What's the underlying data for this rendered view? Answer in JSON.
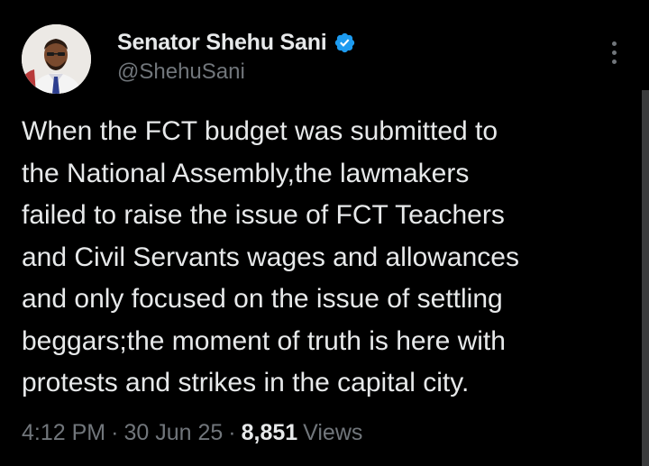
{
  "author": {
    "display_name": "Senator Shehu Sani",
    "handle": "@ShehuSani",
    "verified_color": "#1d9bf0"
  },
  "tweet": {
    "text": "When the FCT budget was submitted to\nthe National Assembly,the lawmakers\nfailed to raise the issue of FCT Teachers\nand Civil Servants wages and allowances\nand only focused on the issue of settling\nbeggars;the moment of truth is here with\nprotests and strikes in the capital city.",
    "time": "4:12 PM",
    "date": "30 Jun 25",
    "separator": "·",
    "views_count": "8,851",
    "views_label": "Views"
  },
  "icons": {
    "verified": "verified-badge-icon",
    "more": "more-options-icon"
  },
  "colors": {
    "background": "#000000",
    "primary_text": "#e7e9ea",
    "secondary_text": "#71767b"
  }
}
